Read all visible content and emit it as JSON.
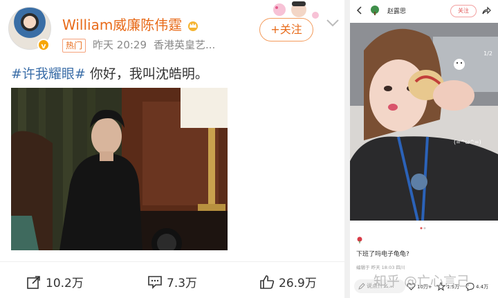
{
  "left_post": {
    "username": "William威廉陈伟霆",
    "hot_badge": "热门",
    "time": "昨天 20:29",
    "source": "香港英皇艺...",
    "follow_label": "+关注",
    "verified_badge": "v",
    "text_hashtag": "#许我耀眼#",
    "text_body": " 你好，我叫沈皓明。",
    "actions": {
      "repost_count": "10.2万",
      "comment_count": "7.3万",
      "like_count": "26.9万"
    },
    "colors": {
      "accent": "#e86b1a",
      "hashtag": "#3b6ea8"
    }
  },
  "right_post": {
    "name": "赵露思",
    "follow_label": "关注",
    "pager": "1/2",
    "photo_caption": "(=^ω^=)",
    "caption": "下班了吗电子龟龟?",
    "meta": "编辑于 昨天 18:03 四川",
    "input_placeholder": "说点什么...",
    "stats": {
      "repost": "10万+",
      "favorite": "1.9万",
      "comment": "4.4万"
    }
  },
  "watermark": "知乎 @亡心言己"
}
